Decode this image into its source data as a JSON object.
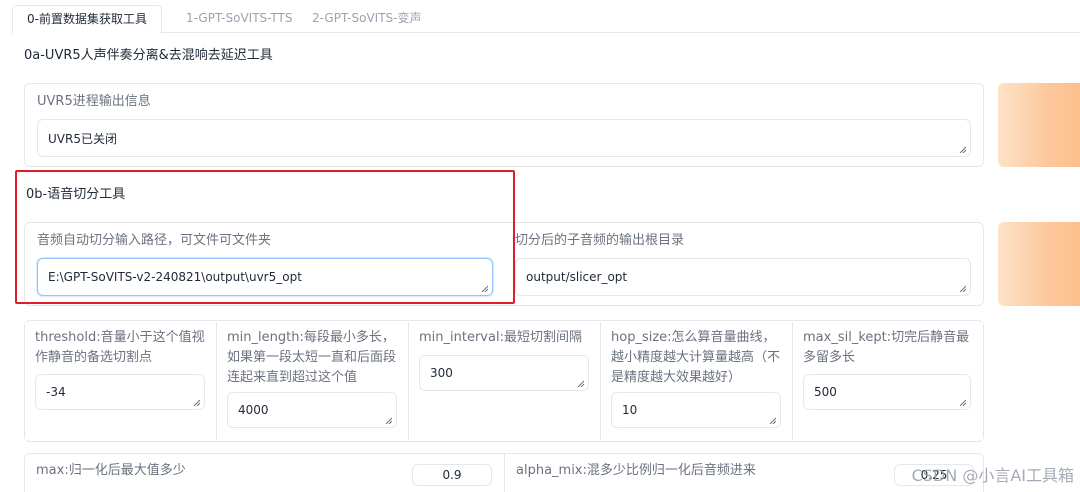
{
  "tabs": [
    "0-前置数据集获取工具",
    "1-GPT-SoVITS-TTS",
    "2-GPT-SoVITS-变声"
  ],
  "uvr5": {
    "section_title": "0a-UVR5人声伴奏分离&去混响去延迟工具",
    "info_label": "UVR5进程输出信息",
    "info_value": "UVR5已关闭"
  },
  "slicer": {
    "section_title": "0b-语音切分工具",
    "input_label": "音频自动切分输入路径，可文件可文件夹",
    "input_value": "E:\\GPT-SoVITS-v2-240821\\output\\uvr5_opt",
    "output_label": "切分后的子音频的输出根目录",
    "output_value": "output/slicer_opt"
  },
  "params": [
    {
      "label": "threshold:音量小于这个值视作静音的备选切割点",
      "value": "-34"
    },
    {
      "label": "min_length:每段最小多长，如果第一段太短一直和后面段连起来直到超过这个值",
      "value": "4000"
    },
    {
      "label": "min_interval:最短切割间隔",
      "value": "300"
    },
    {
      "label": "hop_size:怎么算音量曲线，越小精度越大计算量越高（不是精度越大效果越好）",
      "value": "10"
    },
    {
      "label": "max_sil_kept:切完后静音最多留多长",
      "value": "500"
    }
  ],
  "bottom": {
    "max_label": "max:归一化后最大值多少",
    "max_value": "0.9",
    "alpha_label": "alpha_mix:混多少比例归一化后音频进来",
    "alpha_value": "0.25"
  },
  "watermark": "CSDN @小言AI工具箱",
  "colors": {
    "accent_red": "#e11d2b",
    "orange_button": "#fcc89c",
    "focus_border": "#93c5fd"
  }
}
